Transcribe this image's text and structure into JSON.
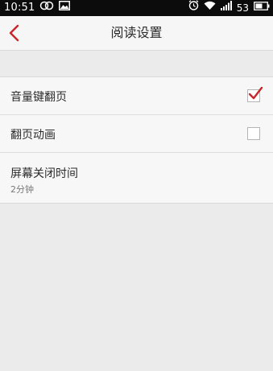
{
  "status_bar": {
    "time": "10:51",
    "battery_level": "53",
    "icons": [
      "dual-circle-icon",
      "image-icon",
      "alarm-icon",
      "wifi-icon",
      "signal-icon",
      "battery-icon"
    ]
  },
  "header": {
    "title": "阅读设置",
    "back_icon": "chevron-left-icon"
  },
  "settings": {
    "items": [
      {
        "label": "音量键翻页",
        "checked": true
      },
      {
        "label": "翻页动画",
        "checked": false
      },
      {
        "label": "屏幕关闭时间",
        "value": "2分钟"
      }
    ]
  },
  "colors": {
    "accent": "#c8262a",
    "status_bar": "#0c0c0c",
    "background": "#ebebeb",
    "list_background": "#f7f7f7"
  }
}
